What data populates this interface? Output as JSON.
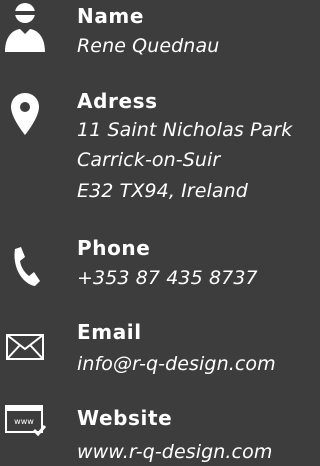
{
  "contact": {
    "name": {
      "icon": "user-icon",
      "label": "Name",
      "value": "Rene Quednau"
    },
    "address": {
      "icon": "map-pin-icon",
      "label": "Adress",
      "lines": [
        "11 Saint Nicholas Park",
        "Carrick-on-Suir",
        "E32 TX94, Ireland"
      ]
    },
    "phone": {
      "icon": "phone-icon",
      "label": "Phone",
      "value": "+353 87 435 8737"
    },
    "email": {
      "icon": "envelope-icon",
      "label": "Email",
      "value": "info@r-q-design.com"
    },
    "website": {
      "icon": "browser-window-icon",
      "label": "Website",
      "value": "www.r-q-design.com",
      "icon_text": "www"
    }
  },
  "colors": {
    "background": "#3d3d3d",
    "text": "#ffffff"
  }
}
